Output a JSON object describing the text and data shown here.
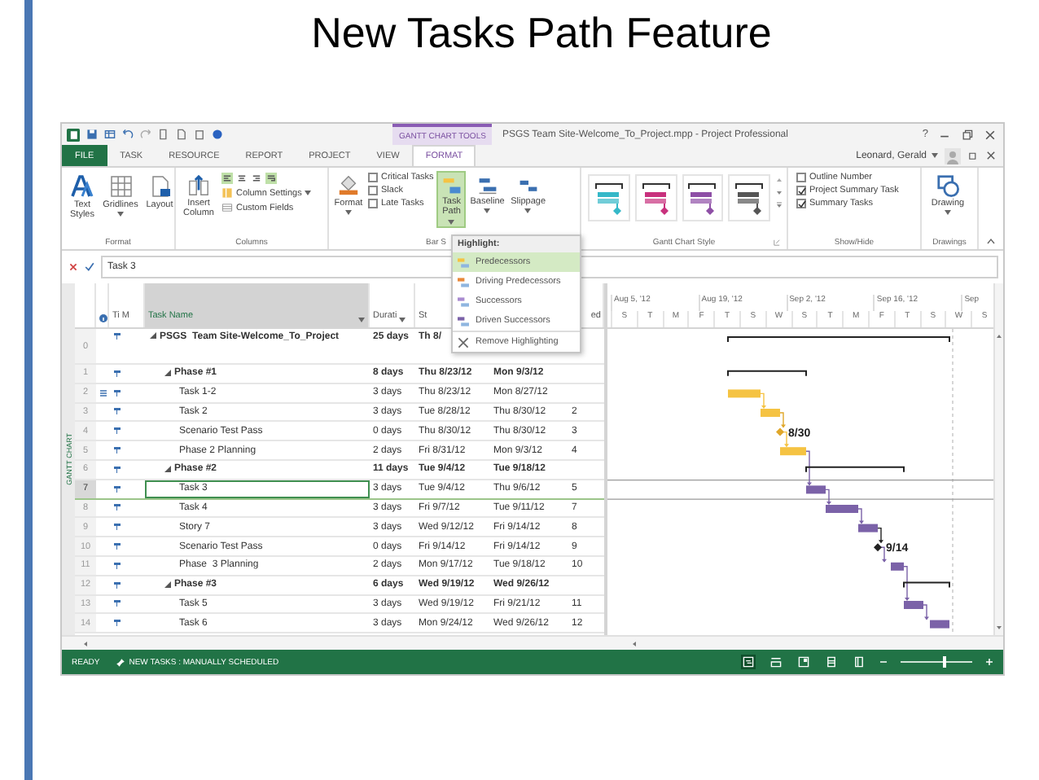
{
  "slide": {
    "title": "New Tasks Path Feature"
  },
  "window": {
    "context_tab": "GANTT CHART TOOLS",
    "title": "PSGS Team Site-Welcome_To_Project.mpp - Project Professional",
    "help": "?"
  },
  "tabs": [
    {
      "label": "FILE",
      "kind": "file",
      "selected": false
    },
    {
      "label": "TASK",
      "kind": "tab",
      "selected": false
    },
    {
      "label": "RESOURCE",
      "kind": "tab",
      "selected": false
    },
    {
      "label": "REPORT",
      "kind": "tab",
      "selected": false
    },
    {
      "label": "PROJECT",
      "kind": "tab",
      "selected": false
    },
    {
      "label": "VIEW",
      "kind": "tab",
      "selected": false
    },
    {
      "label": "FORMAT",
      "kind": "tab",
      "selected": true
    }
  ],
  "user": {
    "name": "Leonard, Gerald"
  },
  "ribbon": {
    "format_group": {
      "label": "Format",
      "buttons": [
        {
          "label": "Text Styles",
          "kind": "text"
        },
        {
          "label": "Gridlines",
          "kind": "grid"
        },
        {
          "label": "Layout",
          "kind": "layout"
        }
      ]
    },
    "columns_group": {
      "label": "Columns",
      "insert": "Insert Column",
      "column_settings": "Column Settings",
      "custom_fields": "Custom Fields"
    },
    "bar_styles_group": {
      "label": "Bar S",
      "format": "Format",
      "checkboxes": [
        {
          "label": "Critical Tasks",
          "checked": false
        },
        {
          "label": "Slack",
          "checked": false
        },
        {
          "label": "Late Tasks",
          "checked": false
        }
      ],
      "task_path": {
        "label": "Task Path",
        "selected": true
      },
      "baseline": "Baseline",
      "slippage": "Slippage"
    },
    "gantt_style_group": {
      "label": "Gantt Chart Style",
      "styles": [
        {
          "color": "#35b8c8"
        },
        {
          "color": "#c8317d"
        },
        {
          "color": "#8e4fa6"
        },
        {
          "color": "#555555"
        }
      ]
    },
    "show_hide_group": {
      "label": "Show/Hide",
      "checkboxes": [
        {
          "label": "Outline Number",
          "checked": false
        },
        {
          "label": "Project Summary Task",
          "checked": true
        },
        {
          "label": "Summary Tasks",
          "checked": true
        }
      ]
    },
    "drawings_group": {
      "label": "Drawings",
      "drawing": "Drawing"
    }
  },
  "menu": {
    "header": "Highlight:",
    "items": [
      {
        "label": "Predecessors",
        "kind": "highlight",
        "color": "#f5c343",
        "selected": true
      },
      {
        "label": "Driving Predecessors",
        "kind": "highlight",
        "color": "#e8893a",
        "selected": false
      },
      {
        "label": "Successors",
        "kind": "highlight",
        "color": "#a98bd0",
        "selected": false
      },
      {
        "label": "Driven Successors",
        "kind": "highlight",
        "color": "#7b62a8",
        "selected": false
      },
      {
        "label": "Remove Highlighting",
        "kind": "remove",
        "selected": false
      }
    ]
  },
  "entry_bar": {
    "value": "Task 3"
  },
  "side_label": "GANTT CHART",
  "table": {
    "columns": {
      "mode": "Ti M",
      "name": "Task Name",
      "duration": "Durati",
      "start": "St",
      "predecessors": "ed"
    },
    "rows": [
      {
        "id": "0",
        "name": "PSGS  Team Site-Welcome_To_Project",
        "duration": "25 days",
        "start": "Th 8/",
        "kind": "summary",
        "expanded": true,
        "selected": false,
        "note": false,
        "children": [
          {
            "id": "1",
            "name": "Phase #1",
            "duration": "8 days",
            "start": "Thu 8/23/12",
            "finish": "Mon 9/3/12",
            "kind": "summary",
            "expanded": true,
            "selected": false,
            "note": false,
            "children": [
              {
                "id": "2",
                "name": "Task 1-2",
                "duration": "3 days",
                "start": "Thu 8/23/12",
                "finish": "Mon 8/27/12",
                "kind": "task",
                "color": "#f5c343",
                "selected": false,
                "note": true
              },
              {
                "id": "3",
                "name": "Task 2",
                "duration": "3 days",
                "start": "Tue 8/28/12",
                "finish": "Thu 8/30/12",
                "predecessors": "2",
                "kind": "task",
                "color": "#f5c343",
                "selected": false,
                "note": false
              },
              {
                "id": "4",
                "name": "Scenario Test Pass",
                "duration": "0 days",
                "start": "Thu 8/30/12",
                "finish": "Thu 8/30/12",
                "predecessors": "3",
                "kind": "milestone",
                "color": "#e0a72a",
                "milestone_label": "8/30",
                "selected": false,
                "note": false
              },
              {
                "id": "5",
                "name": "Phase 2 Planning",
                "duration": "2 days",
                "start": "Fri 8/31/12",
                "finish": "Mon 9/3/12",
                "predecessors": "4",
                "kind": "task",
                "color": "#f5c343",
                "selected": false,
                "note": false
              }
            ]
          },
          {
            "id": "6",
            "name": "Phase #2",
            "duration": "11 days",
            "start": "Tue 9/4/12",
            "finish": "Tue 9/18/12",
            "kind": "summary",
            "expanded": true,
            "selected": false,
            "note": false,
            "children": [
              {
                "id": "7",
                "name": "Task 3",
                "duration": "3 days",
                "start": "Tue 9/4/12",
                "finish": "Thu 9/6/12",
                "predecessors": "5",
                "kind": "task",
                "color": "#7b62a8",
                "selected": true,
                "note": false
              },
              {
                "id": "8",
                "name": "Task 4",
                "duration": "3 days",
                "start": "Fri 9/7/12",
                "finish": "Tue 9/11/12",
                "predecessors": "7",
                "kind": "task",
                "color": "#7b62a8",
                "selected": false,
                "note": false
              },
              {
                "id": "9",
                "name": "Story 7",
                "duration": "3 days",
                "start": "Wed 9/12/12",
                "finish": "Fri 9/14/12",
                "predecessors": "8",
                "kind": "task",
                "color": "#7b62a8",
                "selected": false,
                "note": false
              },
              {
                "id": "10",
                "name": "Scenario Test Pass",
                "duration": "0 days",
                "start": "Fri 9/14/12",
                "finish": "Fri 9/14/12",
                "predecessors": "9",
                "kind": "milestone",
                "color": "#222222",
                "milestone_label": "9/14",
                "selected": false,
                "note": false
              },
              {
                "id": "11",
                "name": "Phase  3 Planning",
                "duration": "2 days",
                "start": "Mon 9/17/12",
                "finish": "Tue 9/18/12",
                "predecessors": "10",
                "kind": "task",
                "color": "#7b62a8",
                "selected": false,
                "note": false
              }
            ]
          },
          {
            "id": "12",
            "name": "Phase #3",
            "duration": "6 days",
            "start": "Wed 9/19/12",
            "finish": "Wed 9/26/12",
            "kind": "summary",
            "expanded": true,
            "selected": false,
            "note": false,
            "children": [
              {
                "id": "13",
                "name": "Task 5",
                "duration": "3 days",
                "start": "Wed 9/19/12",
                "finish": "Fri 9/21/12",
                "predecessors": "11",
                "kind": "task",
                "color": "#7b62a8",
                "selected": false,
                "note": false
              },
              {
                "id": "14",
                "name": "Task 6",
                "duration": "3 days",
                "start": "Mon 9/24/12",
                "finish": "Wed 9/26/12",
                "predecessors": "12",
                "kind": "task",
                "color": "#7b62a8",
                "selected": false,
                "note": false
              }
            ]
          }
        ]
      }
    ]
  },
  "gantt": {
    "timescale_top": [
      "Aug 5, '12",
      "Aug 19, '12",
      "Sep 2, '12",
      "Sep 16, '12",
      "Sep"
    ],
    "timescale_days": [
      "S",
      "T",
      "M",
      "F",
      "T",
      "S",
      "W",
      "S",
      "T",
      "M",
      "F",
      "T",
      "S",
      "W",
      "S"
    ]
  },
  "status_bar": {
    "ready": "READY",
    "mode": "NEW TASKS : MANUALLY SCHEDULED",
    "zoom": {
      "level": 0.62
    }
  }
}
